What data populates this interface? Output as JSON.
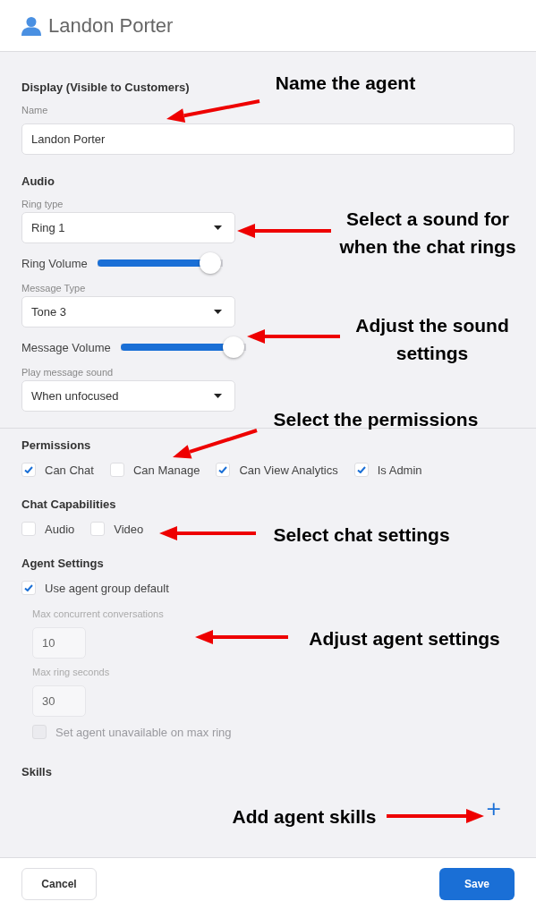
{
  "header": {
    "title": "Landon Porter"
  },
  "display": {
    "heading": "Display (Visible to Customers)",
    "name_field": {
      "label": "Name",
      "value": "Landon Porter"
    }
  },
  "audio": {
    "heading": "Audio",
    "controls": [
      {
        "kind": "select",
        "label": "Ring type",
        "value": "Ring 1"
      },
      {
        "kind": "slider",
        "label": "Ring Volume",
        "level": 0.9
      },
      {
        "kind": "select",
        "label": "Message Type",
        "value": "Tone 3"
      },
      {
        "kind": "slider",
        "label": "Message Volume",
        "level": 0.9
      },
      {
        "kind": "select",
        "label": "Play message sound",
        "value": "When unfocused"
      }
    ]
  },
  "permissions": {
    "heading": "Permissions",
    "options": [
      {
        "label": "Can Chat",
        "checked": true
      },
      {
        "label": "Can Manage",
        "checked": false
      },
      {
        "label": "Can View Analytics",
        "checked": true
      },
      {
        "label": "Is Admin",
        "checked": true
      }
    ]
  },
  "chat_capabilities": {
    "heading": "Chat Capabilities",
    "options": [
      {
        "label": "Audio",
        "checked": false
      },
      {
        "label": "Video",
        "checked": false
      }
    ]
  },
  "agent_settings": {
    "heading": "Agent Settings",
    "items": [
      {
        "kind": "checkbox",
        "label": "Use agent group default",
        "checked": true,
        "disabled": false
      },
      {
        "kind": "number",
        "label": "Max concurrent conversations",
        "value": "10",
        "disabled": true
      },
      {
        "kind": "number",
        "label": "Max ring seconds",
        "value": "30",
        "disabled": true
      },
      {
        "kind": "checkbox",
        "label": "Set agent unavailable on max ring",
        "checked": false,
        "disabled": true
      }
    ]
  },
  "skills": {
    "heading": "Skills",
    "add_button": "+"
  },
  "footer": {
    "buttons": [
      {
        "label": "Cancel",
        "kind": "secondary"
      },
      {
        "label": "Save",
        "kind": "primary"
      }
    ]
  },
  "annotations": [
    {
      "text": "Name the agent"
    },
    {
      "text": "Select a sound for when the chat rings"
    },
    {
      "text": "Adjust the sound settings"
    },
    {
      "text": "Select the permissions"
    },
    {
      "text": "Select chat settings"
    },
    {
      "text": "Adjust agent settings"
    },
    {
      "text": "Add agent skills"
    }
  ]
}
